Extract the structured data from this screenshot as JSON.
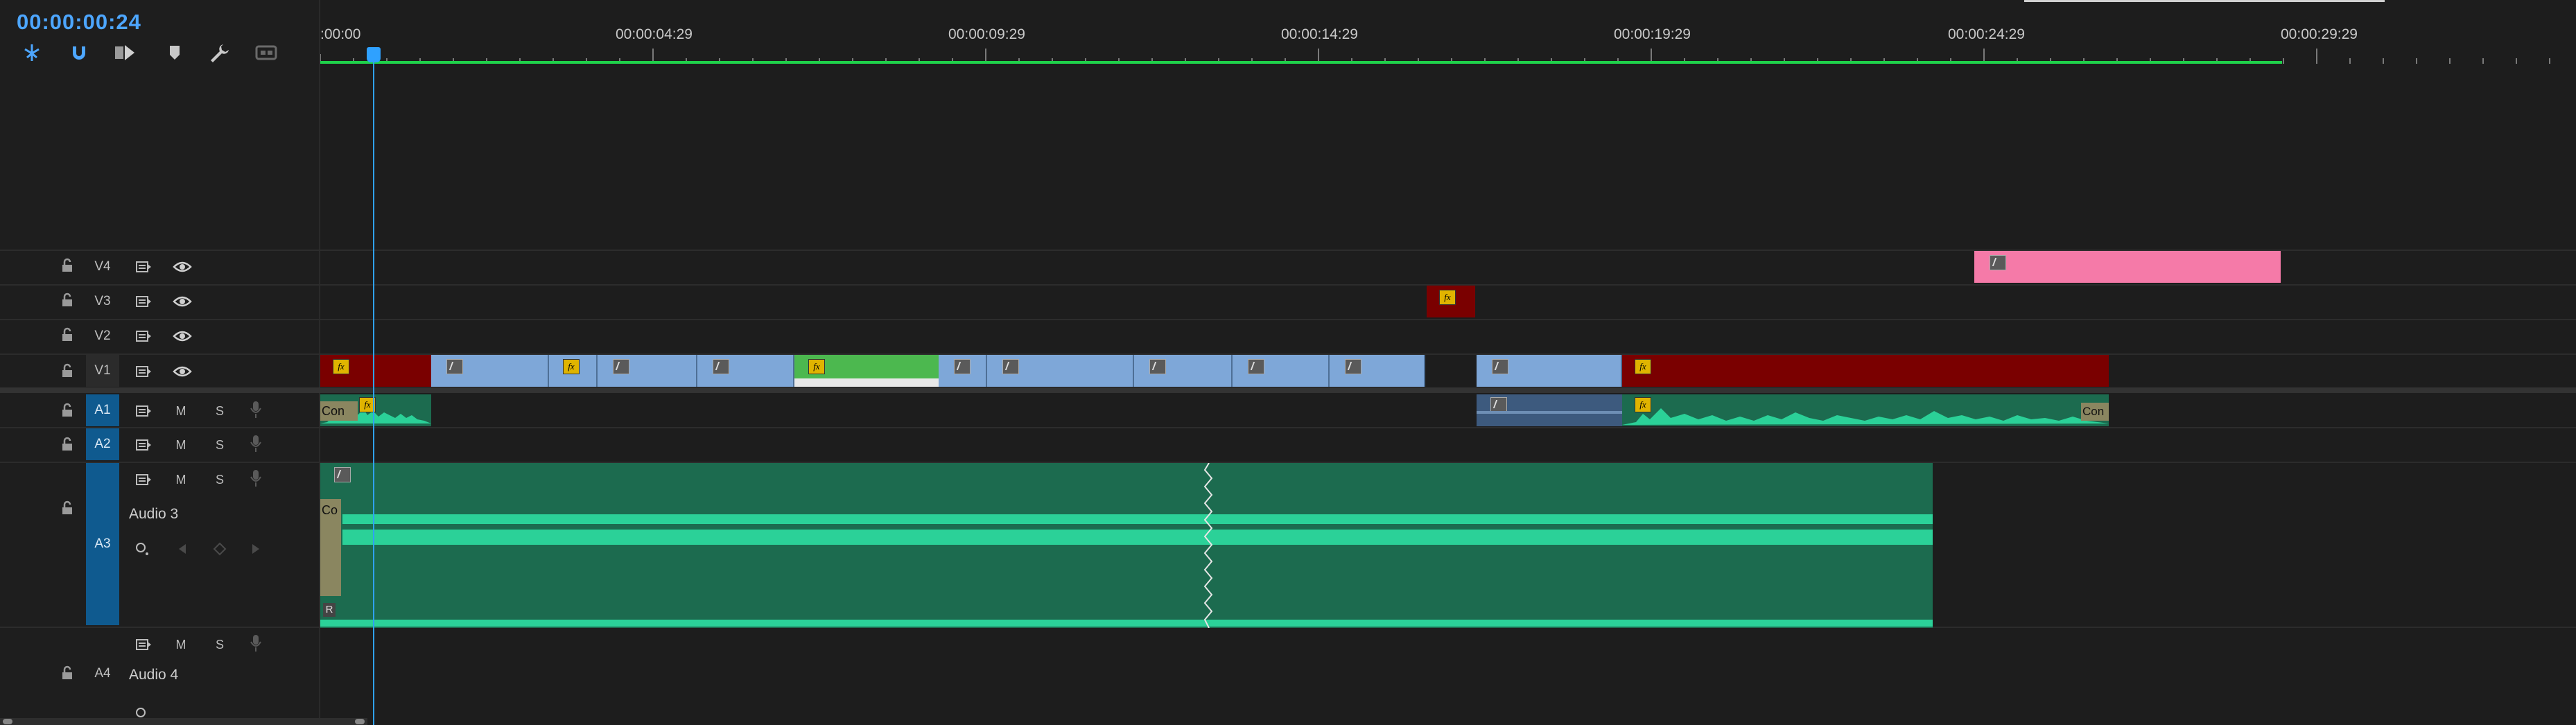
{
  "timecode": "00:00:00:24",
  "toolbar": {
    "icons": [
      "nest-sequence-icon",
      "snap-magnet-icon",
      "linked-selection-icon",
      "marker-icon",
      "wrench-icon",
      "captions-icon"
    ]
  },
  "ruler": {
    "labels": [
      ":00:00",
      "00:00:04:29",
      "00:00:09:29",
      "00:00:14:29",
      "00:00:19:29",
      "00:00:24:29",
      "00:00:29:29"
    ]
  },
  "tracks": {
    "v4": "V4",
    "v3": "V3",
    "v2": "V2",
    "v1": "V1",
    "a1": "A1",
    "a2": "A2",
    "a3": "A3",
    "a4": "A4",
    "mute": "M",
    "solo": "S",
    "audio3_name": "Audio 3",
    "audio4_name": "Audio 4"
  },
  "clip_labels": {
    "a1_left": "Con",
    "a1_right": "Con",
    "a3_left": "Co",
    "a3_r": "R"
  },
  "colors": {
    "accent_blue": "#2fa1ff",
    "video_blue": "#7ea7d8",
    "video_red": "#7a0000",
    "video_green": "#4cb84f",
    "video_pink": "#f57aa8",
    "audio_green": "#1c6b4f",
    "waveform_green": "#2bd198",
    "work_area_green": "#1fd14a"
  }
}
